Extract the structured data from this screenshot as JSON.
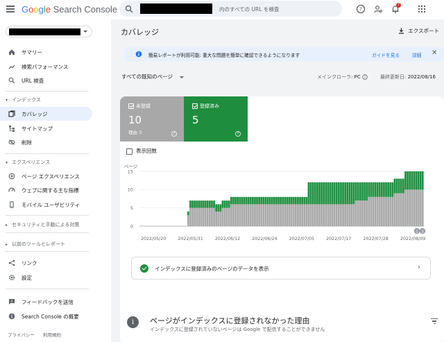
{
  "topbar": {
    "logo": {
      "google": "Google",
      "product": "Search Console"
    },
    "search_placeholder": "内のすべての URL を検査",
    "notification_count": "7"
  },
  "sidebar": {
    "items_top": [
      {
        "label": "サマリー",
        "icon": "home-icon"
      },
      {
        "label": "検索パフォーマンス",
        "icon": "trending-up-icon"
      },
      {
        "label": "URL 検査",
        "icon": "search-icon"
      }
    ],
    "section_index": "インデックス",
    "items_index": [
      {
        "label": "カバレッジ",
        "icon": "coverage-icon",
        "active": true
      },
      {
        "label": "サイトマップ",
        "icon": "sitemap-icon"
      },
      {
        "label": "削除",
        "icon": "eye-off-icon"
      }
    ],
    "section_experience": "エクスペリエンス",
    "items_experience": [
      {
        "label": "ページ エクスペリエンス",
        "icon": "star-add-icon"
      },
      {
        "label": "ウェブに関する主な指標",
        "icon": "speed-icon"
      },
      {
        "label": "モバイル ユーザビリティ",
        "icon": "smartphone-icon"
      }
    ],
    "section_security": "セキュリティと手動による対策",
    "section_legacy": "以前のツールとレポート",
    "items_bottom": [
      {
        "label": "リンク",
        "icon": "links-icon"
      },
      {
        "label": "設定",
        "icon": "gear-icon"
      }
    ],
    "items_footer": [
      {
        "label": "フィードバックを送信",
        "icon": "feedback-icon"
      },
      {
        "label": "Search Console の概要",
        "icon": "info-icon"
      }
    ],
    "footer_links": [
      "プライバシー",
      "利用規約"
    ]
  },
  "main": {
    "title": "カバレッジ",
    "export_label": "エクスポート",
    "banner": {
      "message": "簡易レポートが利用可能: 重大な問題を簡単に確認できるようになります",
      "guide_link": "ガイドを見る",
      "details_link": "詳細"
    },
    "filter_label": "すべての既知のページ",
    "crawler_label": "メインクローラ:",
    "crawler_value": "PC",
    "updated_label": "最終更新日:",
    "updated_value": "2022/08/16",
    "tiles": [
      {
        "label": "未登録",
        "value": "10",
        "sub": "理由 3"
      },
      {
        "label": "登録済み",
        "value": "5",
        "sub": ""
      }
    ],
    "impressions_label": "表示回数",
    "cta_label": "インデックスに登録済みのページのデータを表示",
    "reasons": {
      "title": "ページがインデックスに登録されなかった理由",
      "subtitle": "インデックスに登録されていないページは Google で配信することができません"
    }
  },
  "colors": {
    "registered": "#1e8e3e",
    "not_registered": "#a8a8a8",
    "accent": "#1a73e8"
  },
  "chart_data": {
    "type": "bar",
    "stacked": true,
    "ylabel": "ページ",
    "ylim": [
      0,
      15
    ],
    "yticks": [
      0,
      5,
      10,
      15
    ],
    "xtick_labels": [
      "2022/05/20",
      "2022/05/31",
      "2022/06/12",
      "2022/06/24",
      "2022/07/05",
      "2022/07/17",
      "2022/07/28",
      "2022/08/09"
    ],
    "annotations": [
      "1",
      "3"
    ],
    "series": [
      {
        "name": "未登録",
        "color": "#a8a8a8",
        "values": [
          3,
          5,
          5,
          5,
          5,
          5,
          5,
          5,
          5,
          5,
          5,
          5,
          5,
          4,
          4,
          4,
          5,
          5,
          5,
          5,
          6,
          6,
          6,
          6,
          6,
          6,
          6,
          6,
          6,
          6,
          6,
          6,
          6,
          6,
          6,
          6,
          6,
          6,
          6,
          6,
          6,
          6,
          6,
          6,
          6,
          6,
          6,
          6,
          6,
          6,
          6,
          6,
          6,
          6,
          6,
          6,
          6,
          6,
          6,
          6,
          6,
          6,
          6,
          6,
          6,
          6,
          6,
          6,
          6,
          6,
          6,
          6,
          6,
          6,
          6,
          6,
          6,
          6,
          7,
          7,
          7,
          7,
          7,
          7,
          8,
          8,
          8,
          8,
          8,
          8,
          8,
          8,
          8,
          8,
          8,
          8,
          9,
          9,
          9,
          9,
          9,
          10,
          10,
          10,
          10,
          10,
          10,
          10,
          10,
          10
        ]
      },
      {
        "name": "登録済み",
        "color": "#1e8e3e",
        "values": [
          1,
          2,
          2,
          2,
          2,
          2,
          2,
          2,
          2,
          2,
          2,
          2,
          2,
          2,
          2,
          2,
          2,
          2,
          2,
          2,
          2,
          2,
          2,
          2,
          2,
          2,
          2,
          2,
          2,
          2,
          2,
          2,
          2,
          2,
          2,
          2,
          2,
          2,
          2,
          2,
          2,
          2,
          2,
          2,
          2,
          2,
          2,
          2,
          2,
          2,
          2,
          2,
          2,
          2,
          2,
          2,
          6,
          6,
          6,
          6,
          6,
          6,
          6,
          6,
          6,
          6,
          6,
          6,
          6,
          6,
          6,
          6,
          6,
          6,
          6,
          6,
          6,
          6,
          5,
          5,
          5,
          5,
          5,
          5,
          4,
          4,
          4,
          4,
          4,
          4,
          4,
          4,
          4,
          4,
          4,
          4,
          4,
          4,
          4,
          4,
          4,
          5,
          5,
          5,
          5,
          5,
          5,
          5,
          5,
          5
        ]
      }
    ]
  }
}
